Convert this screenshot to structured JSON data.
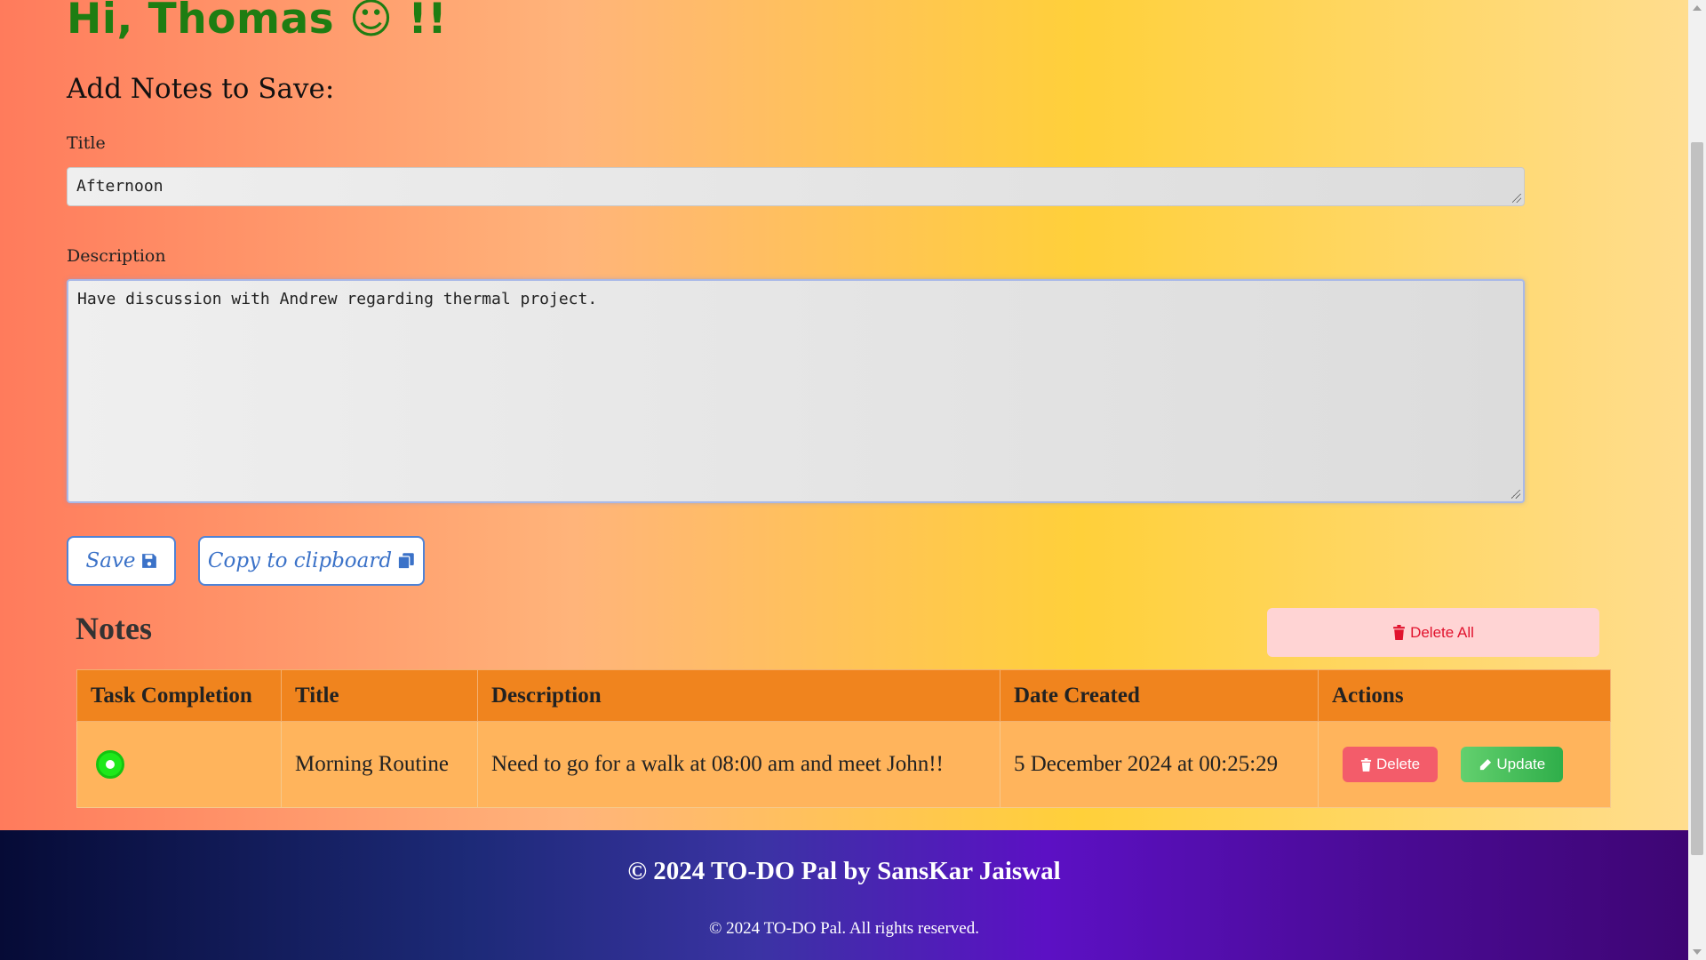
{
  "greeting": "Hi, Thomas ☺ !!",
  "form": {
    "heading": "Add Notes to Save:",
    "title_label": "Title",
    "title_value": "Afternoon",
    "description_label": "Description",
    "description_value": "Have discussion with Andrew regarding thermal project."
  },
  "buttons": {
    "save_label": "Save",
    "copy_label": "Copy to clipboard",
    "save_icon": "floppy-disk-icon",
    "copy_icon": "copy-icon"
  },
  "notes": {
    "heading": "Notes",
    "delete_all_label": "Delete All",
    "columns": [
      "Task Completion",
      "Title",
      "Description",
      "Date Created",
      "Actions"
    ],
    "rows": [
      {
        "completed": true,
        "title": "Morning Routine",
        "description": "Need to go for a walk at 08:00 am and meet John!!",
        "date_created": "5 December 2024 at 00:25:29",
        "delete_label": "Delete",
        "update_label": "Update"
      }
    ]
  },
  "footer": {
    "title": "© 2024 TO-DO Pal by SansKar Jaiswal",
    "copyright": "© 2024 TO-DO Pal. All rights reserved."
  },
  "colors": {
    "greeting": "#1e7d12",
    "header_row": "#f0841e",
    "body_row": "#ffb45c",
    "delete_accent": "#e1122d",
    "completion_dot": "#1ee81a"
  }
}
